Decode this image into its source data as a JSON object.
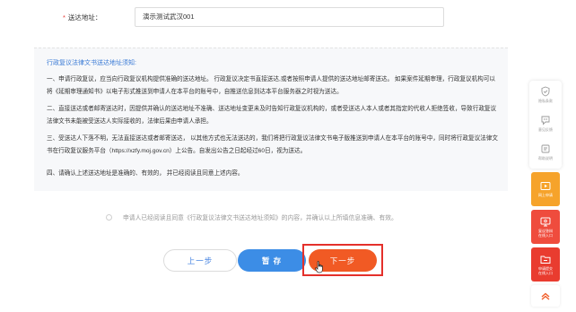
{
  "address": {
    "required_mark": "*",
    "label": "送达地址：",
    "value": "演示测试武汉001"
  },
  "notice": {
    "title": "行政复议法律文书送达地址须知:",
    "paragraphs": [
      "一、申请行政复议，应当向行政复议机构提供准确的送达地址。 行政复议决定书直接送达,或者按照申请人提供的送达地址邮寄送达。 如果案件延期审理，行政复议机构可以将《延期审理通知书》以电子形式推送到申请人在本平台的账号中，自推送信息到达本平台服务器之时视为送达。",
      "二、直接送达或者邮寄送达时，因提供并确认的送达地址不准确、送达地址变更未及时告知行政复议机构的，或者受送达人本人或者其指定的代收人拒绝签收，导致行政复议法律文书未能被受送达人实际接收的，法律后果由申请人承担。",
      "三、受送达人下落不明，无法直接送达或者邮寄送达， 以其他方式也无法送达的，我们将把行政复议法律文书电子版推送到申请人在本平台的账号中，同时将行政复议法律文书在行政复议服务平台（https://xzfy.moj.gov.cn）上公告。自发出公告之日起经过60日，视为送达。",
      "四、请确认上述送达地址是准确的、有效的， 并已经阅读且同意上述内容。"
    ]
  },
  "agree_text": "申请人已经阅读且同意《行政复议法律文书送达地址须知》的内容，并确认以上所填信息准确、有效。",
  "buttons": {
    "prev": "上一步",
    "save": "暂 存",
    "next": "下一步"
  },
  "sidebar": {
    "items": [
      {
        "label": "隐私条款",
        "icon": "shield-icon"
      },
      {
        "label": "意见反馈",
        "icon": "feedback-icon"
      },
      {
        "label": "帮助说明",
        "icon": "help-icon"
      }
    ],
    "colored": [
      {
        "label": "网上申请",
        "icon": "video-icon",
        "color": "#f6a32b"
      },
      {
        "label": "复议答辩\n在线入口",
        "icon": "monitor-icon",
        "color": "#ef4c3d"
      },
      {
        "label": "申请提交\n在线入口",
        "icon": "folder-icon",
        "color": "#e93c2f"
      }
    ],
    "back_to_top_icon": "chevron-up-icon"
  },
  "colors": {
    "accent_blue": "#3c8de6",
    "next_orange": "#f15a24",
    "highlight_red": "#e4302b"
  }
}
